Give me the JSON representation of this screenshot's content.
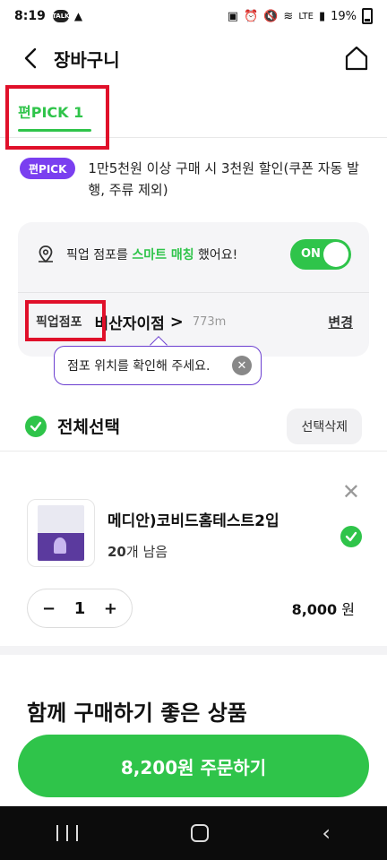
{
  "status": {
    "time": "8:19",
    "talk_badge": "TALK",
    "network": "LTE",
    "battery": "19%"
  },
  "header": {
    "title": "장바구니"
  },
  "tabs": [
    {
      "label": "편PICK 1"
    }
  ],
  "promo": {
    "badge": "편PICK",
    "text": "1만5천원 이상 구매 시 3천원 할인(쿠폰 자동 발행, 주류 제외)"
  },
  "pickup": {
    "msg_pre": "픽업 점포를 ",
    "msg_highlight": "스마트 매칭",
    "msg_post": " 했어요!",
    "toggle_label": "ON",
    "label": "픽업점포",
    "store": "비산자이점",
    "distance": "773m",
    "change": "변경",
    "tooltip": "점포 위치를 확인해 주세요."
  },
  "select_all": {
    "label": "전체선택",
    "delete": "선택삭제"
  },
  "cart_item": {
    "name": "메디안)코비드홈테스트2입",
    "stock_count": "20",
    "stock_suffix": "개 남음",
    "quantity": "1",
    "minus": "−",
    "plus": "+",
    "price": "8,000",
    "currency": "원"
  },
  "reco_title": "함께 구매하기 좋은 상품",
  "order_button": "8,200원 주문하기",
  "colors": {
    "accent": "#2fc44a",
    "purple": "#7a3ff0",
    "highlight_box": "#e0102a"
  }
}
